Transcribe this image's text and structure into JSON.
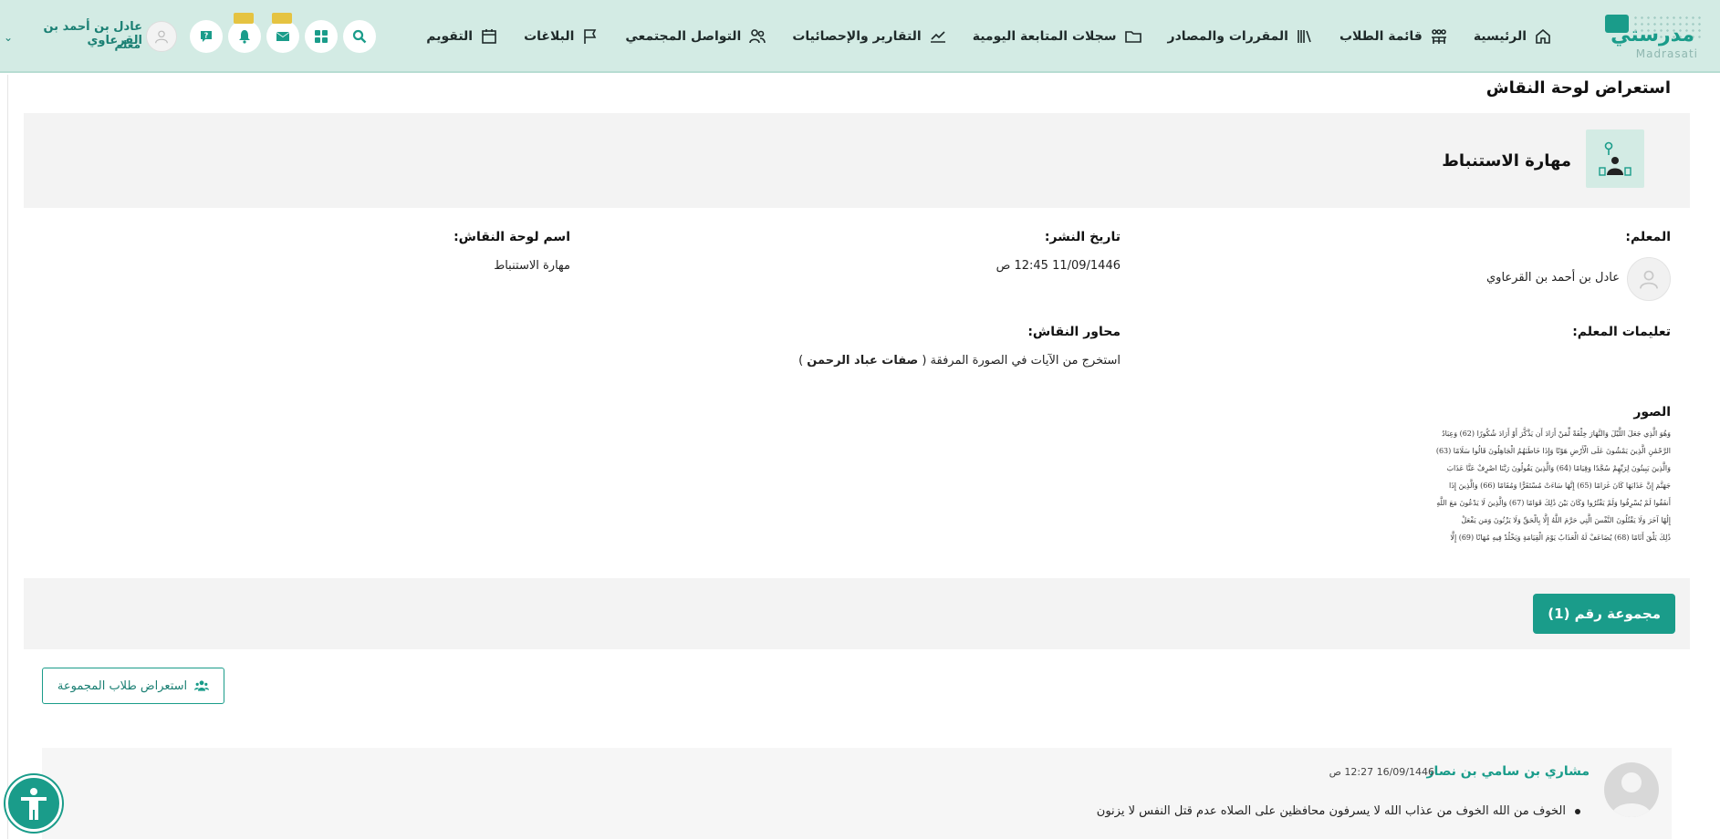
{
  "brand": {
    "name_ar": "مدرستي",
    "name_en": "Madrasati",
    "accent": "#1a9c8a"
  },
  "nav": {
    "items": [
      {
        "label": "الرئيسية",
        "icon": "home-icon"
      },
      {
        "label": "قائمة الطلاب",
        "icon": "students-icon"
      },
      {
        "label": "المقررات والمصادر",
        "icon": "books-icon"
      },
      {
        "label": "سجلات المتابعة اليومية",
        "icon": "folder-icon"
      },
      {
        "label": "التقارير والإحصائيات",
        "icon": "chart-icon"
      },
      {
        "label": "التواصل المجتمعي",
        "icon": "users-icon"
      },
      {
        "label": "البلاغات",
        "icon": "flag-icon"
      },
      {
        "label": "التقويم",
        "icon": "calendar-icon"
      }
    ]
  },
  "user": {
    "name": "عادل بن أحمد بن القرعاوي",
    "role": "معلم"
  },
  "page": {
    "title": "استعراض لوحة النقاش"
  },
  "skill": {
    "title": "مهارة الاستنباط"
  },
  "fields": {
    "teacher_label": "المعلم:",
    "teacher_name": "عادل بن أحمد بن القرعاوي",
    "publish_label": "تاريخ النشر:",
    "publish_value": "11/09/1446 12:45 ص",
    "board_label": "اسم لوحة النقاش:",
    "board_value": "مهارة الاستنباط",
    "instructions_label": "تعليمات المعلم:",
    "axes_label": "محاور النقاش:",
    "axes_value_prefix": "استخرج من الآيات في الصورة المرفقة (",
    "axes_value_bold": "صفات عباد الرحمن",
    "axes_value_suffix": ")",
    "images_label": "الصور"
  },
  "quran_lines": [
    "وَهُوَ الَّذِي جَعَلَ اللَّيْلَ وَالنَّهَارَ خِلْفَةً لِّمَنْ أَرَادَ أَن يَذَّكَّرَ أَوْ أَرَادَ شُكُورًا (62) وَعِبَادُ",
    "الرَّحْمَٰنِ الَّذِينَ يَمْشُونَ عَلَى الْأَرْضِ هَوْنًا وَإِذَا خَاطَبَهُمُ الْجَاهِلُونَ قَالُوا سَلَامًا (63)",
    "وَالَّذِينَ يَبِيتُونَ لِرَبِّهِمْ سُجَّدًا وَقِيَامًا (64) وَالَّذِينَ يَقُولُونَ رَبَّنَا اصْرِفْ عَنَّا عَذَابَ",
    "جَهَنَّمَ إِنَّ عَذَابَهَا كَانَ غَرَامًا (65) إِنَّهَا سَاءَتْ مُسْتَقَرًّا وَمُقَامًا (66) وَالَّذِينَ إِذَا",
    "أَنفَقُوا لَمْ يُسْرِفُوا وَلَمْ يَقْتُرُوا وَكَانَ بَيْنَ ذَٰلِكَ قَوَامًا (67) وَالَّذِينَ لَا يَدْعُونَ مَعَ اللَّهِ",
    "إِلَٰهًا آخَرَ وَلَا يَقْتُلُونَ النَّفْسَ الَّتِي حَرَّمَ اللَّهُ إِلَّا بِالْحَقِّ وَلَا يَزْنُونَ وَمَن يَفْعَلْ",
    "ذَٰلِكَ يَلْقَ أَثَامًا (68) يُضَاعَفْ لَهُ الْعَذَابُ يَوْمَ الْقِيَامَةِ وَيَخْلُدْ فِيهِ مُهَانًا (69) إِلَّا"
  ],
  "group": {
    "label": "مجموعة رقم (1)",
    "students_button": "استعراض طلاب المجموعة"
  },
  "post": {
    "author": "مشاري بن سامي بن نصار",
    "time": "16/09/1446 12:27 ص",
    "text": "الخوف من الله الخوف من عذاب الله لا يسرفون محافظين على الصلاه عدم قتل النفس لا يزنون"
  }
}
